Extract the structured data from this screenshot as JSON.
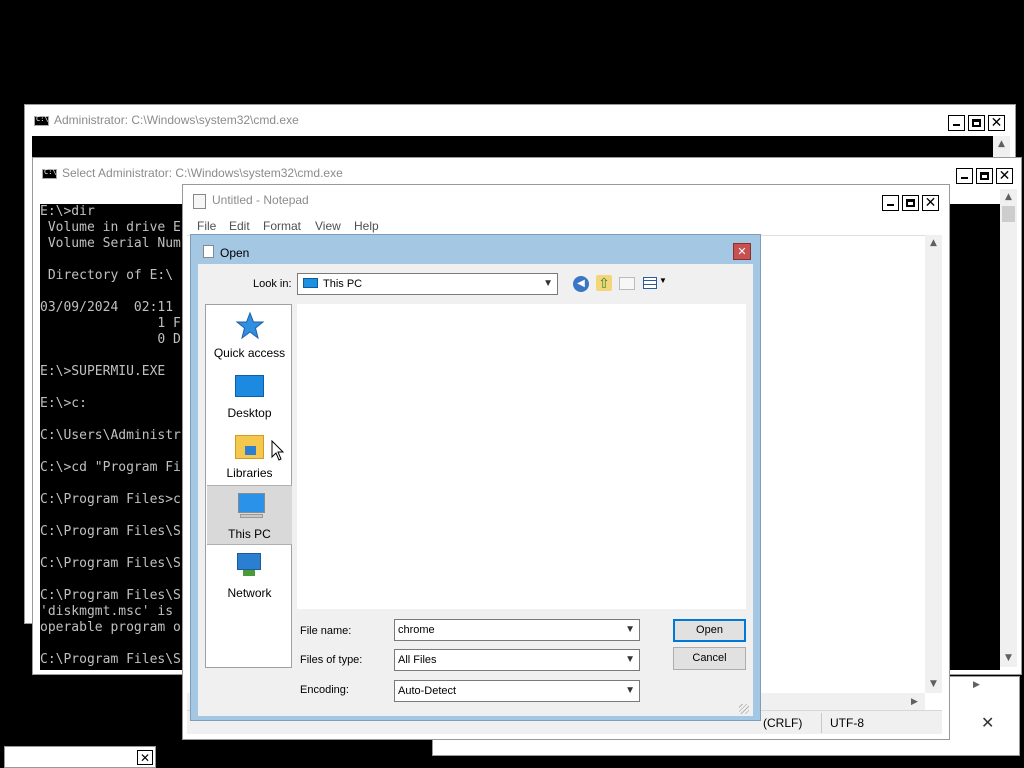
{
  "cmd_back": {
    "title": "Administrator: C:\\Windows\\system32\\cmd.exe"
  },
  "cmd_front": {
    "title": "Select Administrator: C:\\Windows\\system32\\cmd.exe",
    "lines": [
      "E:\\>dir",
      " Volume in drive E",
      " Volume Serial Num",
      "",
      " Directory of E:\\",
      "",
      "03/09/2024  02:11",
      "               1 F",
      "               0 D",
      "",
      "E:\\>SUPERMIU.EXE",
      "",
      "E:\\>c:",
      "",
      "C:\\Users\\Administr",
      "",
      "C:\\>cd \"Program Fi",
      "",
      "C:\\Program Files>c",
      "",
      "C:\\Program Files\\S",
      "",
      "C:\\Program Files\\S",
      "",
      "C:\\Program Files\\S",
      "'diskmgmt.msc' is ",
      "operable program o",
      "",
      "C:\\Program Files\\S"
    ]
  },
  "notepad": {
    "title": "Untitled - Notepad",
    "menu": [
      "File",
      "Edit",
      "Format",
      "View",
      "Help"
    ],
    "status": {
      "line_ending": "(CRLF)",
      "encoding": "UTF-8"
    }
  },
  "open_dialog": {
    "title": "Open",
    "look_in_label": "Look in:",
    "look_in_value": "This PC",
    "places": [
      {
        "label": "Quick access",
        "icon": "star-icon"
      },
      {
        "label": "Desktop",
        "icon": "desktop-icon"
      },
      {
        "label": "Libraries",
        "icon": "libraries-folder-icon"
      },
      {
        "label": "This PC",
        "icon": "computer-icon",
        "selected": true
      },
      {
        "label": "Network",
        "icon": "network-icon"
      }
    ],
    "file_name_label": "File name:",
    "file_name_value": "chrome",
    "file_type_label": "Files of type:",
    "file_type_value": "All Files",
    "encoding_label": "Encoding:",
    "encoding_value": "Auto-Detect",
    "open_button": "Open",
    "cancel_button": "Cancel"
  },
  "colors": {
    "titlebar_bg": "#ffffff",
    "dialog_frame": "#a4c7e4",
    "default_button_border": "#0078d7"
  }
}
